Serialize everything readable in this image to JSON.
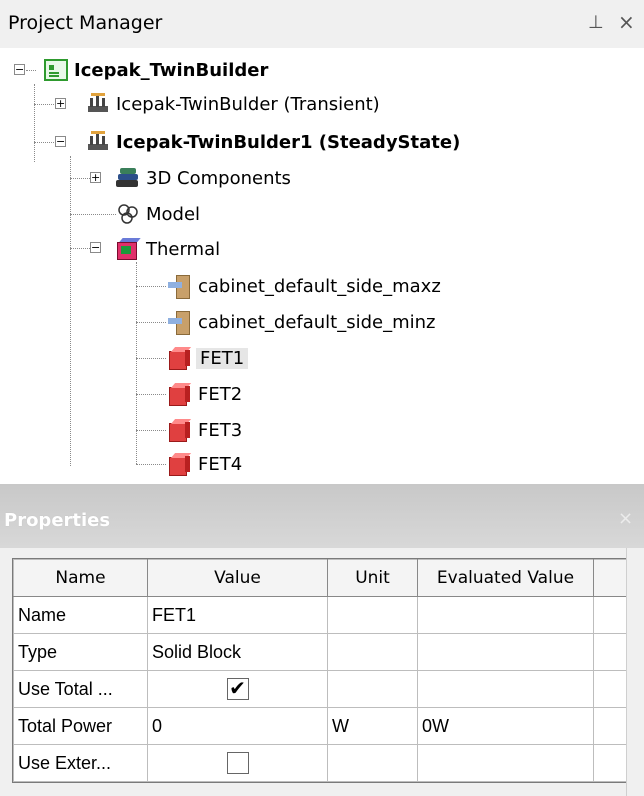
{
  "project_manager": {
    "title": "Project Manager",
    "pin_icon": "pin-icon",
    "close_icon": "close-icon",
    "tree": {
      "project": "Icepak_TwinBuilder",
      "designs": [
        {
          "label": "Icepak-TwinBulder (Transient)",
          "expanded": false
        },
        {
          "label": "Icepak-TwinBulder1 (SteadyState)",
          "expanded": true
        }
      ],
      "design_children": {
        "components": "3D Components",
        "model": "Model",
        "thermal": "Thermal"
      },
      "thermal_items": [
        "cabinet_default_side_maxz",
        "cabinet_default_side_minz",
        "FET1",
        "FET2",
        "FET3",
        "FET4"
      ],
      "selected": "FET1"
    }
  },
  "properties": {
    "title": "Properties",
    "columns": [
      "Name",
      "Value",
      "Unit",
      "Evaluated Value"
    ],
    "rows": [
      {
        "name": "Name",
        "value": "FET1",
        "unit": "",
        "evaluated": ""
      },
      {
        "name": "Type",
        "value": "Solid Block",
        "unit": "",
        "evaluated": ""
      },
      {
        "name": "Use Total ...",
        "value": "checkbox",
        "checked": true,
        "unit": "",
        "evaluated": ""
      },
      {
        "name": "Total Power",
        "value": "0",
        "unit": "W",
        "evaluated": "0W"
      },
      {
        "name": "Use Exter...",
        "value": "checkbox",
        "checked": false,
        "unit": "",
        "evaluated": ""
      }
    ],
    "checkmark_glyph": "✔"
  }
}
